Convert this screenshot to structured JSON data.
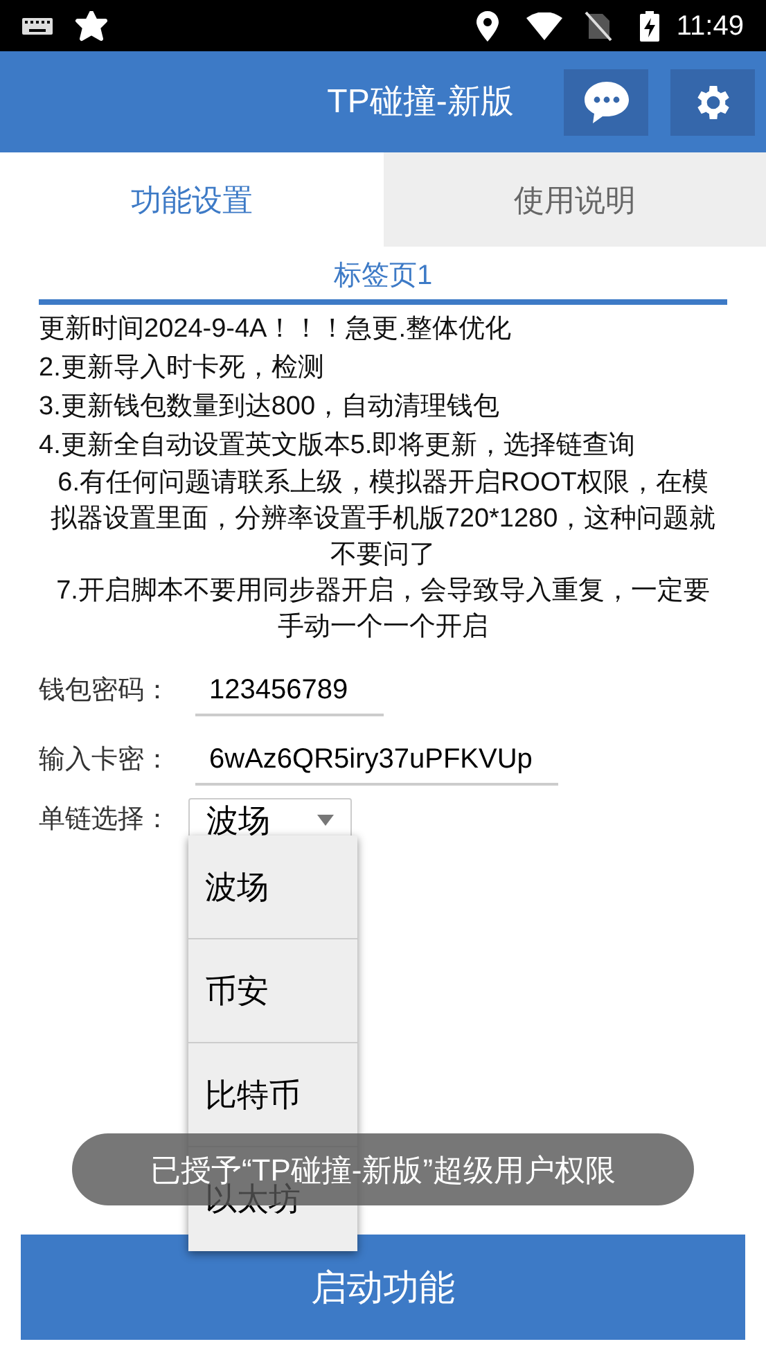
{
  "status_bar": {
    "time": "11:49"
  },
  "app_bar": {
    "title": "TP碰撞-新版"
  },
  "tabs": [
    {
      "label": "功能设置",
      "selected": true
    },
    {
      "label": "使用说明",
      "selected": false
    }
  ],
  "page_tab": {
    "label": "标签页1"
  },
  "notes": [
    {
      "text": "更新时间2024-9-4A！！！急更.整体优化",
      "centered": false
    },
    {
      "text": "2.更新导入时卡死，检测",
      "centered": false
    },
    {
      "text": "3.更新钱包数量到达800，自动清理钱包",
      "centered": false
    },
    {
      "text": "4.更新全自动设置英文版本5.即将更新，选择链查询",
      "centered": false
    },
    {
      "text": "6.有任何问题请联系上级，模拟器开启ROOT权限，在模拟器设置里面，分辨率设置手机版720*1280，这种问题就不要问了",
      "centered": true
    },
    {
      "text": "7.开启脚本不要用同步器开启，会导致导入重复，一定要手动一个一个开启",
      "centered": true
    }
  ],
  "fields": [
    {
      "label": "钱包密码：",
      "value": "123456789",
      "kind": "short"
    },
    {
      "label": "输入卡密：",
      "value": "6wAz6QR5iry37uPFKVUp",
      "kind": "long"
    }
  ],
  "chain_select": {
    "label": "单链选择：",
    "value": "波场",
    "options": [
      "波场",
      "币安",
      "比特币",
      "以太坊"
    ]
  },
  "start_button": {
    "label": "启动功能"
  },
  "toast": {
    "text": "已授予“TP碰撞-新版”超级用户权限"
  }
}
